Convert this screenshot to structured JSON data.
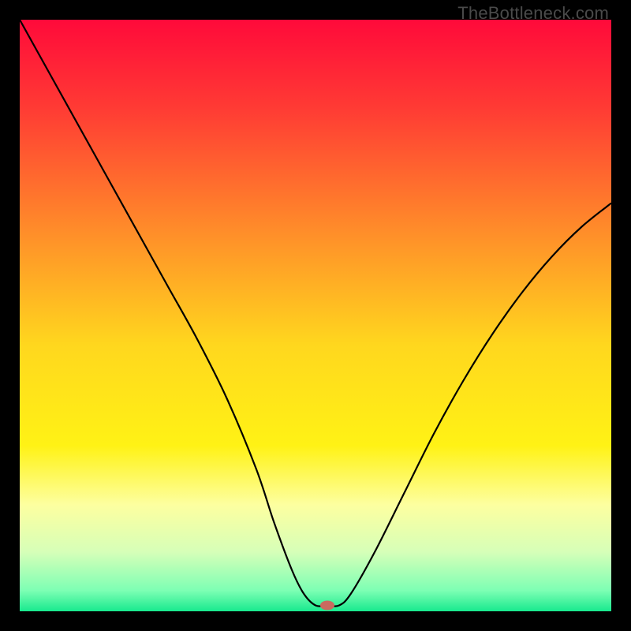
{
  "watermark": "TheBottleneck.com",
  "chart_data": {
    "type": "line",
    "title": "",
    "xlabel": "",
    "ylabel": "",
    "xlim": [
      0,
      100
    ],
    "ylim": [
      0,
      100
    ],
    "background": {
      "type": "vertical-gradient",
      "stops": [
        {
          "pos": 0.0,
          "color": "#ff0a3a"
        },
        {
          "pos": 0.15,
          "color": "#ff3b34"
        },
        {
          "pos": 0.35,
          "color": "#ff8a2a"
        },
        {
          "pos": 0.55,
          "color": "#ffd71e"
        },
        {
          "pos": 0.72,
          "color": "#fff215"
        },
        {
          "pos": 0.82,
          "color": "#fdffa0"
        },
        {
          "pos": 0.9,
          "color": "#d6ffb8"
        },
        {
          "pos": 0.965,
          "color": "#7dffb4"
        },
        {
          "pos": 1.0,
          "color": "#18e98e"
        }
      ]
    },
    "series": [
      {
        "name": "bottleneck-curve",
        "color": "#000000",
        "width": 2.2,
        "x": [
          0,
          5,
          10,
          15,
          20,
          25,
          30,
          35,
          40,
          43,
          46,
          48,
          50,
          52,
          54,
          56,
          60,
          65,
          70,
          75,
          80,
          85,
          90,
          95,
          100
        ],
        "values": [
          100,
          91,
          82,
          73,
          64,
          55,
          46,
          36,
          24,
          15,
          7,
          3,
          1,
          1,
          1,
          3,
          10,
          20,
          30,
          39,
          47,
          54,
          60,
          65,
          69
        ]
      }
    ],
    "marker": {
      "name": "min-point",
      "x": 52,
      "y": 1,
      "color": "#c96a5f",
      "rx": 9,
      "ry": 6
    }
  }
}
